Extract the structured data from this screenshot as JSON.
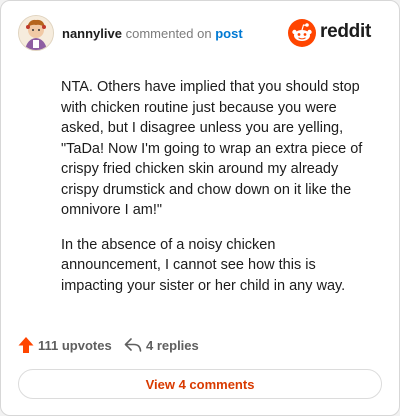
{
  "header": {
    "username": "nannylive",
    "action_text": "commented on",
    "post_link": "post",
    "brand": "reddit"
  },
  "comment": {
    "paragraphs": [
      "NTA. Others have implied that you should stop with chicken routine just because you were asked, but I disagree unless you are yelling, \"TaDa! Now I'm going to wrap an extra piece of crispy fried chicken skin around my already crispy drumstick and chow down on it like the omnivore I am!\"",
      "In the absence of a noisy chicken announcement, I cannot see how this is impacting your sister or her child in any way."
    ]
  },
  "actions": {
    "upvotes": "111 upvotes",
    "replies": "4 replies"
  },
  "footer": {
    "view_comments": "View 4 comments"
  },
  "colors": {
    "brand": "#ff4500",
    "link": "#0079d3",
    "view_button_text": "#d93a00"
  },
  "icons": [
    "avatar",
    "reddit-logo-icon",
    "upvote-arrow-icon",
    "reply-icon"
  ]
}
